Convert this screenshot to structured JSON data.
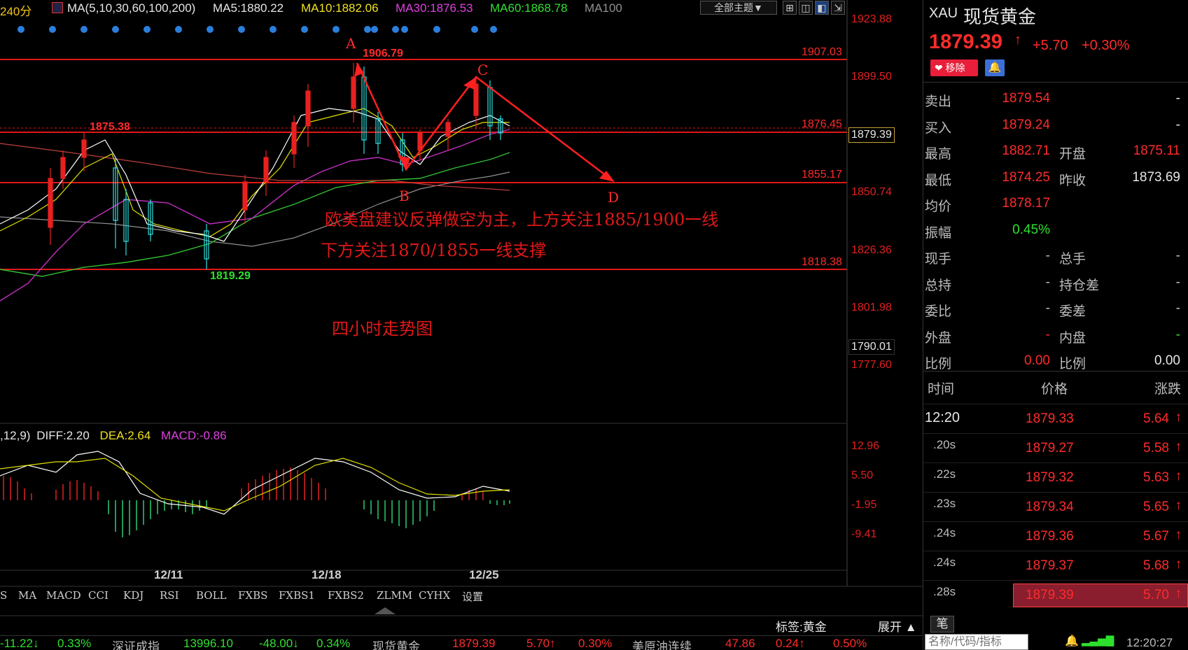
{
  "legend": {
    "period": "240分",
    "ma_params": "MA(5,10,30,60,100,200)",
    "ma5": "MA5:1880.22",
    "ma10": "MA10:1882.06",
    "ma30": "MA30:1876.53",
    "ma60": "MA60:1868.78",
    "ma100": "MA100",
    "theme_button": "全部主题▼"
  },
  "price_axis": [
    "1923.88",
    "1899.50",
    "1850.74",
    "1826.36",
    "1801.98",
    "1777.60"
  ],
  "current_price_box": "1879.39",
  "low_box": "1790.01",
  "levels": {
    "l1907": "1907.03",
    "l1876": "1876.45",
    "l1855": "1855.17",
    "l1818": "1818.38"
  },
  "chart_marks": {
    "high": "1906.79",
    "left_peak": "1875.38",
    "low": "1819.29",
    "pt_a": "A",
    "pt_b": "B",
    "pt_c": "C",
    "pt_d": "D"
  },
  "annotation": {
    "line1": "欧美盘建议反弹做空为主，上方关注1885/1900一线",
    "line2": "下方关注1870/1855一线支撑",
    "caption": "四小时走势图"
  },
  "macd": {
    "params": ",12,9)",
    "diff": "DIFF:2.20",
    "dea": "DEA:2.64",
    "macd": "MACD:-0.86",
    "axis": [
      "12.96",
      "5.50",
      "-1.95",
      "-9.41"
    ]
  },
  "dates": [
    "12/11",
    "12/18",
    "12/25"
  ],
  "tabs": [
    "S",
    "MA",
    "MACD",
    "CCI",
    "KDJ",
    "RSI",
    "BOLL",
    "FXBS",
    "FXBS1",
    "FXBS2",
    "ZLMM",
    "CYHX",
    "设置"
  ],
  "tag_label": "标签:黄金",
  "expand_label": "展开 ▲",
  "pen_label": "笔",
  "search_placeholder": "名称/代码/指标",
  "clock": "12:20:27",
  "ticker": [
    {
      "text": "-11.22↓",
      "color": "#2ee02e"
    },
    {
      "text": "0.33%",
      "color": "#2ee02e"
    },
    {
      "text": "深证成指",
      "color": "#bdbdbd"
    },
    {
      "text": "13996.10",
      "color": "#2ee02e"
    },
    {
      "text": "-48.00↓",
      "color": "#2ee02e"
    },
    {
      "text": "0.34%",
      "color": "#2ee02e"
    },
    {
      "text": "现货黄金",
      "color": "#bdbdbd"
    },
    {
      "text": "1879.39",
      "color": "#ff2b2b"
    },
    {
      "text": "5.70↑",
      "color": "#ff2b2b"
    },
    {
      "text": "0.30%",
      "color": "#ff2b2b"
    },
    {
      "text": "美原油连续",
      "color": "#bdbdbd"
    },
    {
      "text": "47.86",
      "color": "#ff2b2b"
    },
    {
      "text": "0.24↑",
      "color": "#ff2b2b"
    },
    {
      "text": "0.50%",
      "color": "#ff2b2b"
    }
  ],
  "panel": {
    "code": "XAU",
    "name": "现货黄金",
    "price": "1879.39",
    "change": "+5.70",
    "change_pct": "+0.30%",
    "remove_btn": "移除",
    "rows": [
      {
        "l1": "卖出",
        "v1": "1879.54",
        "l2": "",
        "v2": "-"
      },
      {
        "l1": "买入",
        "v1": "1879.24",
        "l2": "",
        "v2": "-"
      },
      {
        "l1": "最高",
        "v1": "1882.71",
        "l2": "开盘",
        "v2": "1875.11"
      },
      {
        "l1": "最低",
        "v1": "1874.25",
        "l2": "昨收",
        "v2": "1873.69"
      },
      {
        "l1": "均价",
        "v1": "1878.17",
        "l2": "",
        "v2": ""
      },
      {
        "l1": "振幅",
        "v1": "0.45%",
        "l2": "",
        "v2": ""
      },
      {
        "l1": "现手",
        "v1": "-",
        "l2": "总手",
        "v2": "-"
      },
      {
        "l1": "总持",
        "v1": "-",
        "l2": "持仓差",
        "v2": "-"
      },
      {
        "l1": "委比",
        "v1": "-",
        "l2": "委差",
        "v2": "-"
      },
      {
        "l1": "外盘",
        "v1": "-",
        "l2": "内盘",
        "v2": "-"
      },
      {
        "l1": "比例",
        "v1": "0.00",
        "l2": "比例",
        "v2": "0.00"
      }
    ],
    "trades_header": [
      "时间",
      "价格",
      "涨跌"
    ],
    "trades": [
      {
        "t": "12:20",
        "p": "1879.33",
        "c": "5.64"
      },
      {
        "t": ".20s",
        "p": "1879.27",
        "c": "5.58"
      },
      {
        "t": ".22s",
        "p": "1879.32",
        "c": "5.63"
      },
      {
        "t": ".23s",
        "p": "1879.34",
        "c": "5.65"
      },
      {
        "t": ".24s",
        "p": "1879.36",
        "c": "5.67"
      },
      {
        "t": ".24s",
        "p": "1879.37",
        "c": "5.68"
      },
      {
        "t": ".28s",
        "p": "1879.39",
        "c": "5.70"
      }
    ]
  }
}
